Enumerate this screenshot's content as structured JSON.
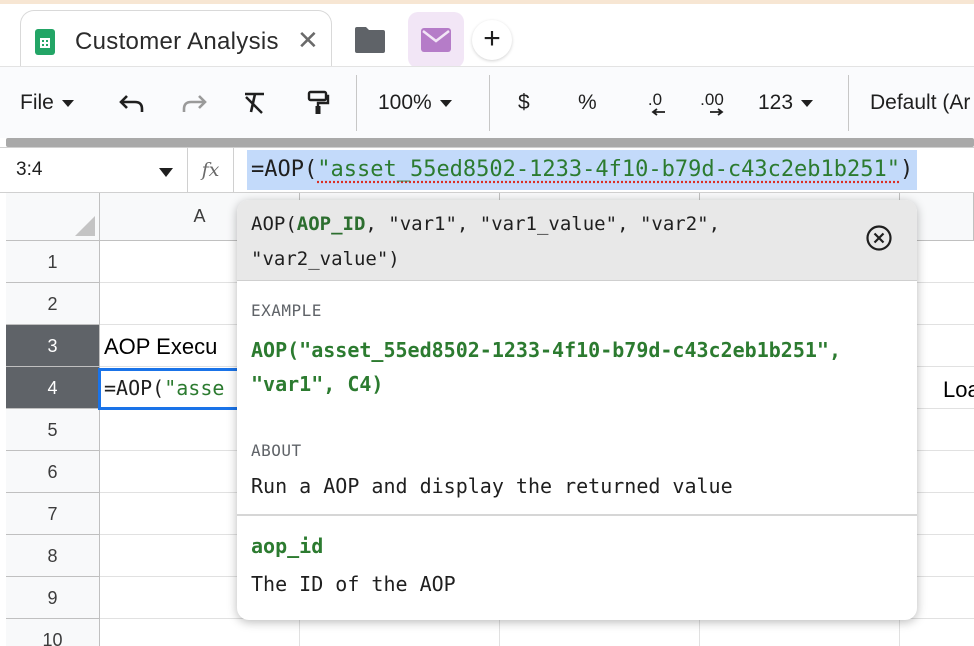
{
  "browser": {
    "active_tab": {
      "title": "Customer Analysis",
      "icon": "google-sheets-icon",
      "close_glyph": "✕"
    },
    "other_tabs": [
      {
        "icon": "folder-icon",
        "color": "#5f6368"
      },
      {
        "icon": "mail-icon",
        "color": "#b57cc8"
      }
    ],
    "new_tab_glyph": "+"
  },
  "toolbar": {
    "file_menu": "File",
    "undo_icon": "undo-icon",
    "redo_icon": "redo-icon",
    "clear_format_icon": "clear-formatting-icon",
    "paint_format_icon": "paint-format-icon",
    "zoom": "100%",
    "currency": "$",
    "percent": "%",
    "decrease_decimal": ".0",
    "increase_decimal": ".00",
    "number_format": "123",
    "font": "Default (Ar"
  },
  "formula_bar": {
    "name_box": "3:4",
    "fx_label": "fx",
    "prefix": "=AOP(",
    "string_arg": "\"asset_55ed8502-1233-4f10-b79d-c43c2eb1b251\"",
    "suffix": ")"
  },
  "grid": {
    "columns": [
      "A",
      "",
      "",
      "",
      ""
    ],
    "rows": [
      "1",
      "2",
      "3",
      "4",
      "5",
      "6",
      "7",
      "8",
      "9",
      "10"
    ],
    "active_rows": [
      "3",
      "4"
    ],
    "cells": {
      "A3": "AOP Execu",
      "E4": "Loa",
      "A4_prefix": "=AOP(",
      "A4_string": "\"asse"
    }
  },
  "function_help": {
    "signature_name": "AOP(",
    "signature_param": "AOP_ID",
    "signature_rest": ", \"var1\", \"var1_value\", \"var2\", \"var2_value\")",
    "close_icon": "close-circle-icon",
    "example_label": "EXAMPLE",
    "example": "AOP(\"asset_55ed8502-1233-4f10-b79d-c43c2eb1b251\", \"var1\", C4)",
    "about_label": "ABOUT",
    "about": "Run a AOP and display the returned value",
    "arg_name": "aop_id",
    "arg_description": "The ID of the AOP"
  },
  "colors": {
    "sheets_green": "#23a566",
    "formula_string": "#2c7b30",
    "selection_blue": "#1a73e8",
    "selection_fill": "#c3dafa",
    "active_row_header": "#5f6368"
  }
}
